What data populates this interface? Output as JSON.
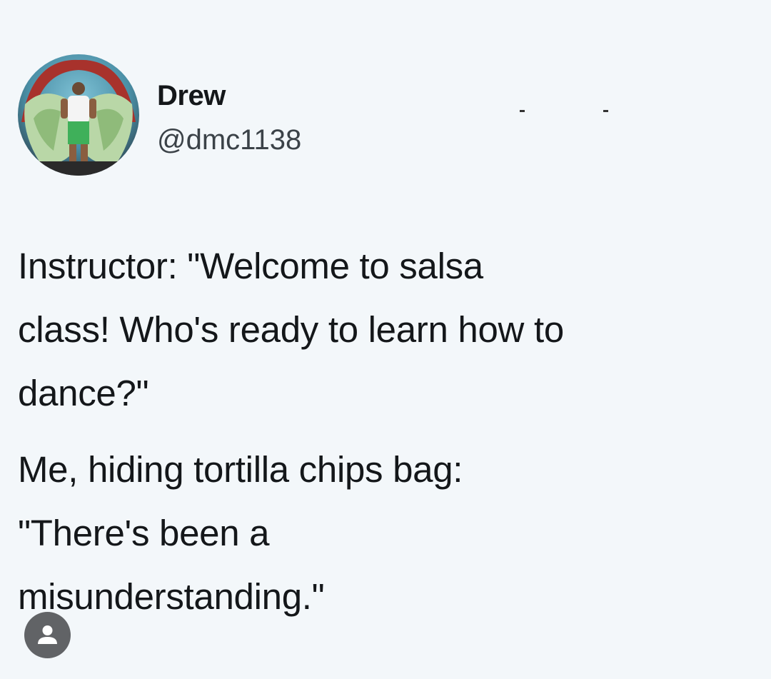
{
  "tweet": {
    "author": {
      "display_name": "Drew",
      "handle": "@dmc1138",
      "avatar_icon": "profile-photo"
    },
    "paragraphs": [
      "Instructor: \"Welcome to salsa\nclass! Who's ready to learn how to\ndance?\"",
      "Me, hiding tortilla chips bag:\n\"There's been a\nmisunderstanding.\""
    ]
  },
  "overlay": {
    "tag_button_icon": "person-icon"
  },
  "colors": {
    "background": "#f3f7fa",
    "text": "#14171a",
    "handle": "#3b4248",
    "tag_button": "#616366"
  }
}
